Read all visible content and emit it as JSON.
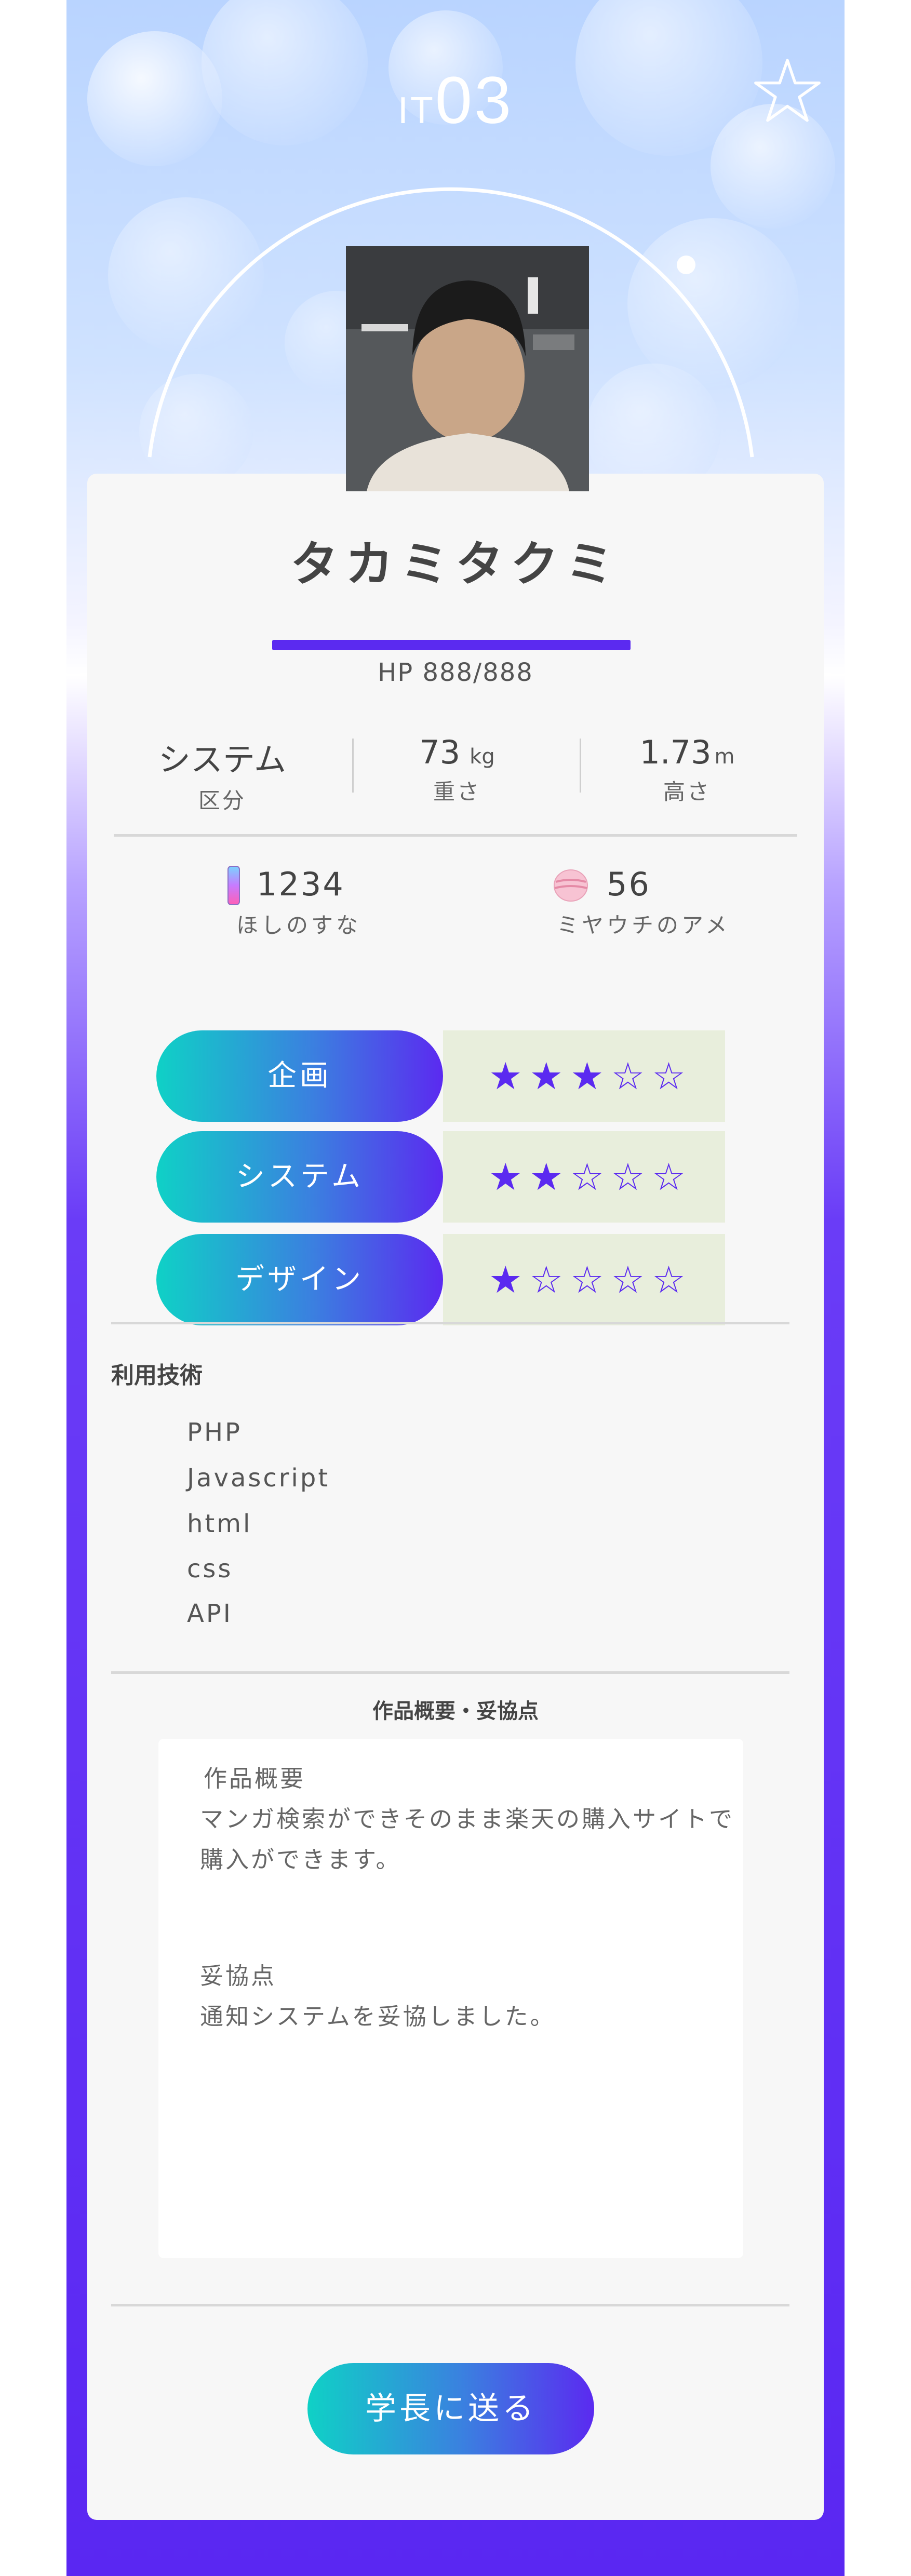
{
  "header": {
    "title_prefix": "IT",
    "title_number": "03"
  },
  "profile": {
    "name": "タカミタクミ",
    "hp": "HP 888/888",
    "hp_fraction": 1.0,
    "stats": [
      {
        "value": "システム",
        "unit": "",
        "label": "区分"
      },
      {
        "value": "73",
        "unit": "kg",
        "label": "重さ"
      },
      {
        "value": "1.73",
        "unit": "m",
        "label": "高さ"
      }
    ],
    "candies": [
      {
        "value": "1234",
        "label": "ほしのすな",
        "icon": "stardust-icon"
      },
      {
        "value": "56",
        "label": "ミヤウチのアメ",
        "icon": "candy-icon"
      }
    ]
  },
  "skills": [
    {
      "label": "企画",
      "rating": 3,
      "max": 5,
      "stars": "★★★☆☆"
    },
    {
      "label": "システム",
      "rating": 2,
      "max": 5,
      "stars": "★★☆☆☆"
    },
    {
      "label": "デザイン",
      "rating": 1,
      "max": 5,
      "stars": "★☆☆☆☆"
    }
  ],
  "technologies": {
    "title": "利用技術",
    "items": [
      "PHP",
      "Javascript",
      "html",
      "css",
      "API"
    ]
  },
  "description": {
    "title": "作品概要・妥協点",
    "summary_heading": "作品概要",
    "summary_line1": "マンガ検索ができそのまま楽天の購入サイトで",
    "summary_line2": "購入ができます。",
    "compromise_heading": "妥協点",
    "compromise_text": "通知システムを妥協しました。"
  },
  "actions": {
    "send_label": "学長に送る"
  },
  "colors": {
    "accent": "#5b2af0",
    "teal": "#0fd1c6",
    "rating_bg": "#e8eedc",
    "card": "#f7f7f7"
  }
}
